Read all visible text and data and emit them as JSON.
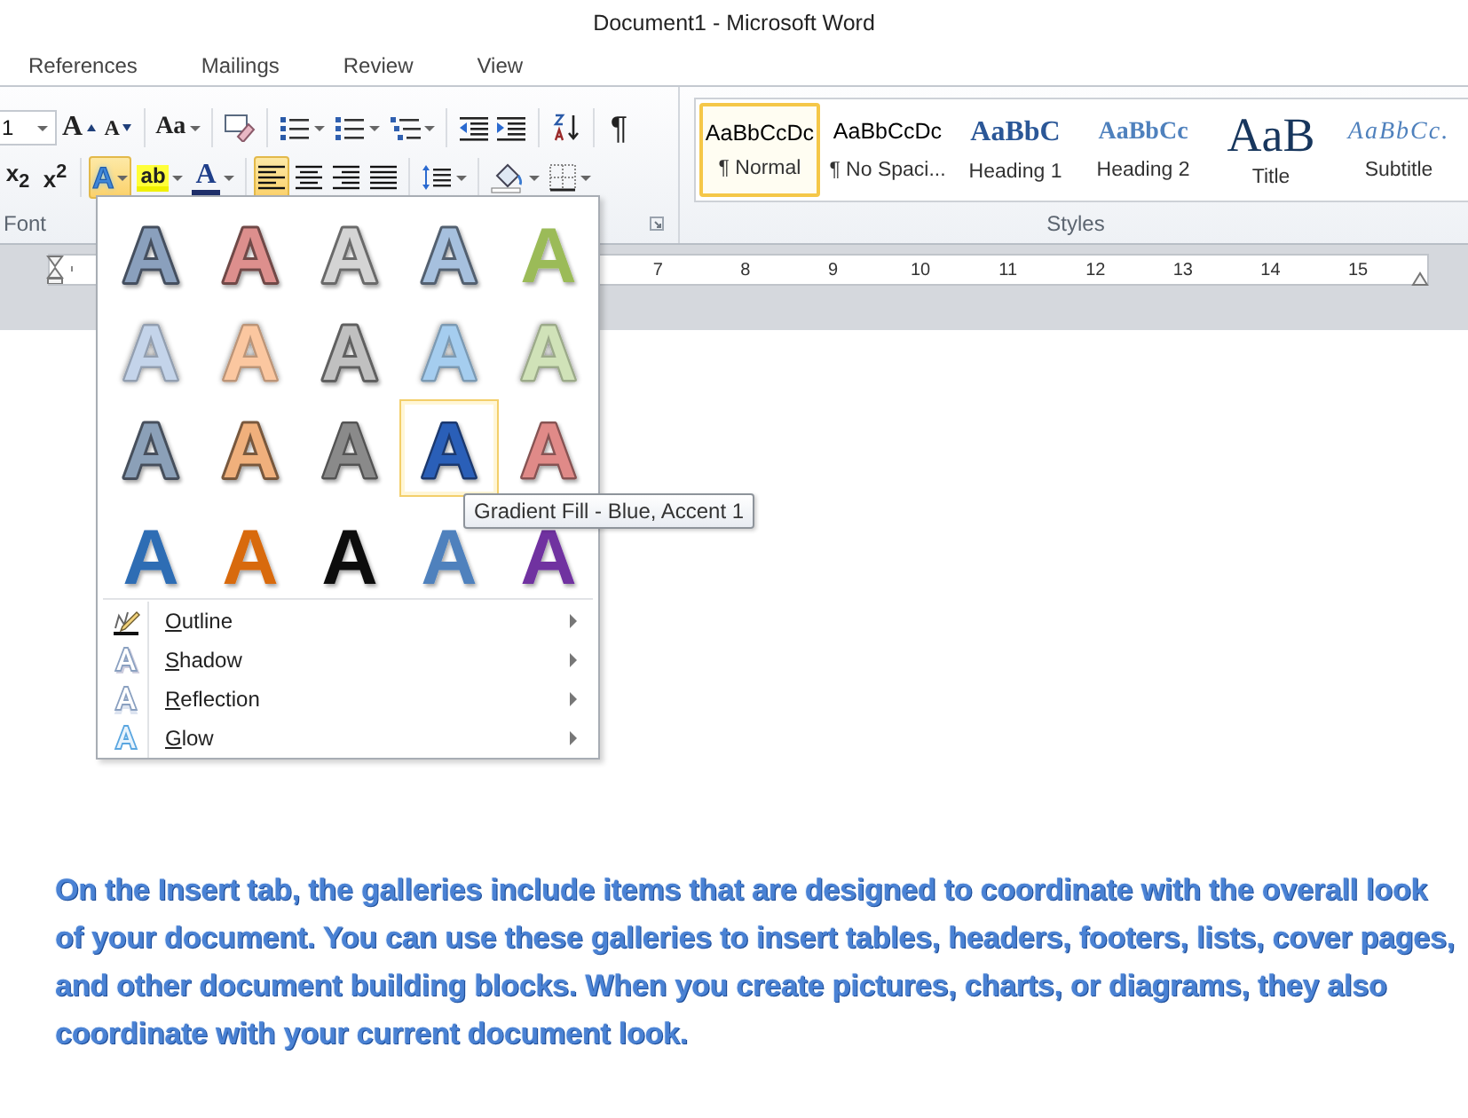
{
  "window": {
    "title": "Document1  -  Microsoft Word"
  },
  "tabs": [
    {
      "label": "References",
      "selected": false
    },
    {
      "label": "Mailings",
      "selected": false
    },
    {
      "label": "Review",
      "selected": false
    },
    {
      "label": "View",
      "selected": false
    }
  ],
  "ribbon": {
    "row_1": [
      [
        {
          "kind": "field",
          "value": "1"
        },
        {
          "kind": "grow",
          "label": "A"
        },
        {
          "kind": "shrink",
          "label": "A"
        }
      ],
      [
        {
          "kind": "case",
          "label": "Aa"
        }
      ],
      [
        {
          "kind": "clear"
        }
      ],
      [
        {
          "kind": "bullets"
        },
        {
          "kind": "numbering"
        },
        {
          "kind": "multilevel"
        }
      ],
      [
        {
          "kind": "outdent"
        },
        {
          "kind": "indent"
        }
      ],
      [
        {
          "kind": "sort"
        }
      ],
      [
        {
          "kind": "pilcrow",
          "label": "¶"
        }
      ]
    ],
    "row_2": [
      [
        {
          "kind": "subscript",
          "label": "x$_{2}$"
        },
        {
          "kind": "superscript",
          "label": "x$^{2}$"
        }
      ],
      [
        {
          "kind": "effects",
          "label": "A",
          "expanded": true
        },
        {
          "kind": "highlight",
          "label": "ab"
        },
        {
          "kind": "fontcolor",
          "label": "A"
        }
      ],
      [
        {
          "kind": "align-left",
          "selected": true
        },
        {
          "kind": "align-center",
          "selected": false
        },
        {
          "kind": "align-right",
          "selected": false
        },
        {
          "kind": "justify",
          "selected": false
        }
      ],
      [
        {
          "kind": "spacing"
        }
      ],
      [
        {
          "kind": "shading"
        },
        {
          "kind": "borders"
        }
      ]
    ],
    "font_label": "Font",
    "styles": [
      {
        "sample": "AaBbCcDc",
        "label": "¶ Normal",
        "kind": "normal",
        "selected": true
      },
      {
        "sample": "AaBbCcDc",
        "label": "¶ No Spaci...",
        "kind": "normal",
        "selected": false
      },
      {
        "sample": "AaBbC",
        "label": "Heading 1",
        "kind": "heading1",
        "selected": false
      },
      {
        "sample": "AaBbCc",
        "label": "Heading 2",
        "kind": "heading2",
        "selected": false
      },
      {
        "sample": "AaB",
        "label": "Title",
        "kind": "title",
        "selected": false
      },
      {
        "sample": "AaBbCc.",
        "label": "Subtitle",
        "kind": "subtitle",
        "selected": false
      }
    ],
    "styles_label": "Styles"
  },
  "ruler": {
    "numbers": [
      "7",
      "8",
      "9",
      "10",
      "11",
      "12",
      "13",
      "14",
      "15"
    ]
  },
  "text_effects_menu": {
    "swatches": [
      {
        "label": "A",
        "kind": "outline",
        "color": "#8aa0bd",
        "selected": false
      },
      {
        "label": "A",
        "kind": "outline",
        "color": "#dd8f8d",
        "selected": false
      },
      {
        "label": "A",
        "kind": "outline",
        "color": "#d4d4d4",
        "selected": false
      },
      {
        "label": "A",
        "kind": "outline",
        "color": "#a6c0de",
        "selected": false
      },
      {
        "label": "A",
        "kind": "solid",
        "color": "#9bbb59",
        "selected": false
      },
      {
        "label": "A",
        "kind": "glow",
        "color": "#c4d4ea",
        "selected": false
      },
      {
        "label": "A",
        "kind": "glow",
        "color": "#fbc7a0",
        "selected": false
      },
      {
        "label": "A",
        "kind": "outline",
        "color": "#c0c0c0",
        "selected": false
      },
      {
        "label": "A",
        "kind": "glow",
        "color": "#a5cdef",
        "selected": false
      },
      {
        "label": "A",
        "kind": "glow",
        "color": "#d0e2b8",
        "selected": false
      },
      {
        "label": "A",
        "kind": "outline",
        "color": "#8ba0b8",
        "selected": false
      },
      {
        "label": "A",
        "kind": "outline",
        "color": "#f0b07c",
        "selected": false
      },
      {
        "label": "A",
        "kind": "gradient",
        "color": "#8a8a8a",
        "selected": false
      },
      {
        "label": "A",
        "kind": "gradient",
        "color": "#2c5fb8",
        "selected": true
      },
      {
        "label": "A",
        "kind": "gradient",
        "color": "#e08a88",
        "selected": false
      },
      {
        "label": "A",
        "kind": "solid",
        "color": "#2e6db4",
        "selected": false
      },
      {
        "label": "A",
        "kind": "solid",
        "color": "#d86a10",
        "selected": false
      },
      {
        "label": "A",
        "kind": "solid",
        "color": "#111111",
        "selected": false
      },
      {
        "label": "A",
        "kind": "solid",
        "color": "#4f81bd",
        "selected": false
      },
      {
        "label": "A",
        "kind": "solid",
        "color": "#7030a0",
        "selected": false
      }
    ],
    "items": [
      {
        "label": "Outline",
        "kind": "outline"
      },
      {
        "label": "Shadow",
        "kind": "shadow"
      },
      {
        "label": "Reflection",
        "kind": "reflection"
      },
      {
        "label": "Glow",
        "kind": "glow"
      }
    ]
  },
  "tooltip": "Gradient Fill - Blue, Accent 1",
  "document": {
    "lines": [
      "On the Insert tab, the galleries include items that are designed to coordinate with the overall look",
      "of your document.  You can use these galleries to insert tables, headers, footers, lists, cover pages,",
      "and other document building blocks. When you create pictures, charts, or diagrams, they also",
      "coordinate with your current document look."
    ]
  }
}
